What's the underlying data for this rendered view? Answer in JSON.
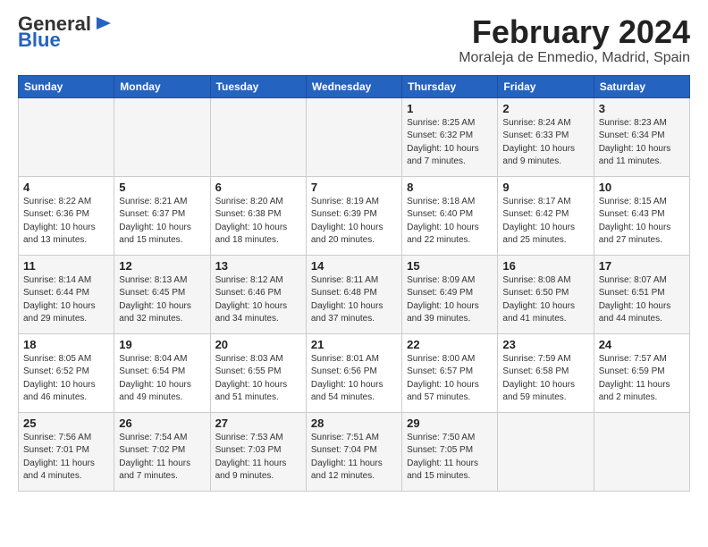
{
  "logo": {
    "general": "General",
    "blue": "Blue",
    "icon": "▶"
  },
  "title": {
    "month": "February 2024",
    "location": "Moraleja de Enmedio, Madrid, Spain"
  },
  "calendar": {
    "headers": [
      "Sunday",
      "Monday",
      "Tuesday",
      "Wednesday",
      "Thursday",
      "Friday",
      "Saturday"
    ],
    "rows": [
      [
        {
          "day": "",
          "info": ""
        },
        {
          "day": "",
          "info": ""
        },
        {
          "day": "",
          "info": ""
        },
        {
          "day": "",
          "info": ""
        },
        {
          "day": "1",
          "info": "Sunrise: 8:25 AM\nSunset: 6:32 PM\nDaylight: 10 hours\nand 7 minutes."
        },
        {
          "day": "2",
          "info": "Sunrise: 8:24 AM\nSunset: 6:33 PM\nDaylight: 10 hours\nand 9 minutes."
        },
        {
          "day": "3",
          "info": "Sunrise: 8:23 AM\nSunset: 6:34 PM\nDaylight: 10 hours\nand 11 minutes."
        }
      ],
      [
        {
          "day": "4",
          "info": "Sunrise: 8:22 AM\nSunset: 6:36 PM\nDaylight: 10 hours\nand 13 minutes."
        },
        {
          "day": "5",
          "info": "Sunrise: 8:21 AM\nSunset: 6:37 PM\nDaylight: 10 hours\nand 15 minutes."
        },
        {
          "day": "6",
          "info": "Sunrise: 8:20 AM\nSunset: 6:38 PM\nDaylight: 10 hours\nand 18 minutes."
        },
        {
          "day": "7",
          "info": "Sunrise: 8:19 AM\nSunset: 6:39 PM\nDaylight: 10 hours\nand 20 minutes."
        },
        {
          "day": "8",
          "info": "Sunrise: 8:18 AM\nSunset: 6:40 PM\nDaylight: 10 hours\nand 22 minutes."
        },
        {
          "day": "9",
          "info": "Sunrise: 8:17 AM\nSunset: 6:42 PM\nDaylight: 10 hours\nand 25 minutes."
        },
        {
          "day": "10",
          "info": "Sunrise: 8:15 AM\nSunset: 6:43 PM\nDaylight: 10 hours\nand 27 minutes."
        }
      ],
      [
        {
          "day": "11",
          "info": "Sunrise: 8:14 AM\nSunset: 6:44 PM\nDaylight: 10 hours\nand 29 minutes."
        },
        {
          "day": "12",
          "info": "Sunrise: 8:13 AM\nSunset: 6:45 PM\nDaylight: 10 hours\nand 32 minutes."
        },
        {
          "day": "13",
          "info": "Sunrise: 8:12 AM\nSunset: 6:46 PM\nDaylight: 10 hours\nand 34 minutes."
        },
        {
          "day": "14",
          "info": "Sunrise: 8:11 AM\nSunset: 6:48 PM\nDaylight: 10 hours\nand 37 minutes."
        },
        {
          "day": "15",
          "info": "Sunrise: 8:09 AM\nSunset: 6:49 PM\nDaylight: 10 hours\nand 39 minutes."
        },
        {
          "day": "16",
          "info": "Sunrise: 8:08 AM\nSunset: 6:50 PM\nDaylight: 10 hours\nand 41 minutes."
        },
        {
          "day": "17",
          "info": "Sunrise: 8:07 AM\nSunset: 6:51 PM\nDaylight: 10 hours\nand 44 minutes."
        }
      ],
      [
        {
          "day": "18",
          "info": "Sunrise: 8:05 AM\nSunset: 6:52 PM\nDaylight: 10 hours\nand 46 minutes."
        },
        {
          "day": "19",
          "info": "Sunrise: 8:04 AM\nSunset: 6:54 PM\nDaylight: 10 hours\nand 49 minutes."
        },
        {
          "day": "20",
          "info": "Sunrise: 8:03 AM\nSunset: 6:55 PM\nDaylight: 10 hours\nand 51 minutes."
        },
        {
          "day": "21",
          "info": "Sunrise: 8:01 AM\nSunset: 6:56 PM\nDaylight: 10 hours\nand 54 minutes."
        },
        {
          "day": "22",
          "info": "Sunrise: 8:00 AM\nSunset: 6:57 PM\nDaylight: 10 hours\nand 57 minutes."
        },
        {
          "day": "23",
          "info": "Sunrise: 7:59 AM\nSunset: 6:58 PM\nDaylight: 10 hours\nand 59 minutes."
        },
        {
          "day": "24",
          "info": "Sunrise: 7:57 AM\nSunset: 6:59 PM\nDaylight: 11 hours\nand 2 minutes."
        }
      ],
      [
        {
          "day": "25",
          "info": "Sunrise: 7:56 AM\nSunset: 7:01 PM\nDaylight: 11 hours\nand 4 minutes."
        },
        {
          "day": "26",
          "info": "Sunrise: 7:54 AM\nSunset: 7:02 PM\nDaylight: 11 hours\nand 7 minutes."
        },
        {
          "day": "27",
          "info": "Sunrise: 7:53 AM\nSunset: 7:03 PM\nDaylight: 11 hours\nand 9 minutes."
        },
        {
          "day": "28",
          "info": "Sunrise: 7:51 AM\nSunset: 7:04 PM\nDaylight: 11 hours\nand 12 minutes."
        },
        {
          "day": "29",
          "info": "Sunrise: 7:50 AM\nSunset: 7:05 PM\nDaylight: 11 hours\nand 15 minutes."
        },
        {
          "day": "",
          "info": ""
        },
        {
          "day": "",
          "info": ""
        }
      ]
    ]
  }
}
